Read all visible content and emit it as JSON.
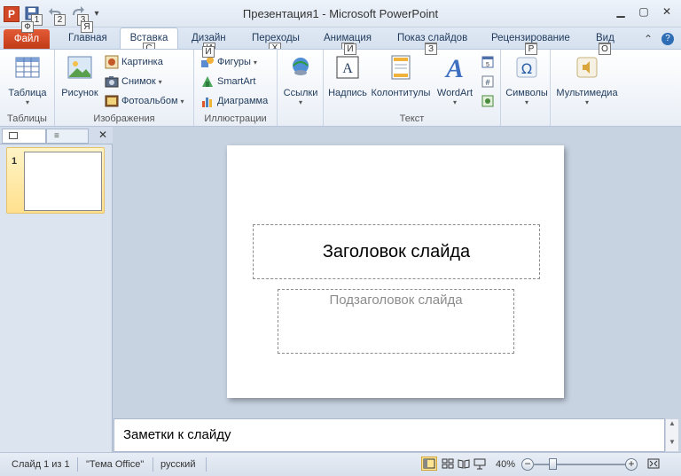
{
  "window": {
    "title": "Презентация1  -  Microsoft PowerPoint",
    "app_icon_letter": "P",
    "qat_keytips": [
      "1",
      "2",
      "3"
    ],
    "controls": [
      "minimize-icon",
      "restore-icon",
      "close-icon"
    ]
  },
  "tabs": [
    {
      "label": "Файл",
      "keytip": "Ф"
    },
    {
      "label": "Главная",
      "keytip": "Я"
    },
    {
      "label": "Вставка",
      "keytip": "С"
    },
    {
      "label": "Дизайн",
      "keytip": "И"
    },
    {
      "label": "Переходы",
      "keytip": "Х"
    },
    {
      "label": "Анимация",
      "keytip": "И"
    },
    {
      "label": "Показ слайдов",
      "keytip": "З"
    },
    {
      "label": "Рецензирование",
      "keytip": "Р"
    },
    {
      "label": "Вид",
      "keytip": "О"
    }
  ],
  "ribbon": {
    "groups": {
      "tables": "Таблицы",
      "images": "Изображения",
      "illustrations": "Иллюстрации",
      "text": "Текст"
    },
    "buttons": {
      "table": "Таблица",
      "picture": "Рисунок",
      "clipart": "Картинка",
      "screenshot": "Снимок",
      "photo_album": "Фотоальбом",
      "shapes": "Фигуры",
      "smartart": "SmartArt",
      "chart": "Диаграмма",
      "links": "Ссылки",
      "textbox": "Надпись",
      "header_footer": "Колонтитулы",
      "wordart": "WordArt",
      "symbols": "Символы",
      "media": "Мультимедиа"
    }
  },
  "slides_pane": {
    "slide_number": "1",
    "close_glyph": "✕"
  },
  "slide": {
    "title_placeholder": "Заголовок слайда",
    "subtitle_placeholder": "Подзаголовок слайда"
  },
  "notes": {
    "placeholder": "Заметки к слайду"
  },
  "status": {
    "slide_info": "Слайд 1 из 1",
    "theme": "\"Тема Office\"",
    "language": "русский",
    "zoom": "40%"
  },
  "colors": {
    "file_tab": "#d24726",
    "accent": "#1e395b",
    "selected_thumb": "#ffe08e"
  }
}
